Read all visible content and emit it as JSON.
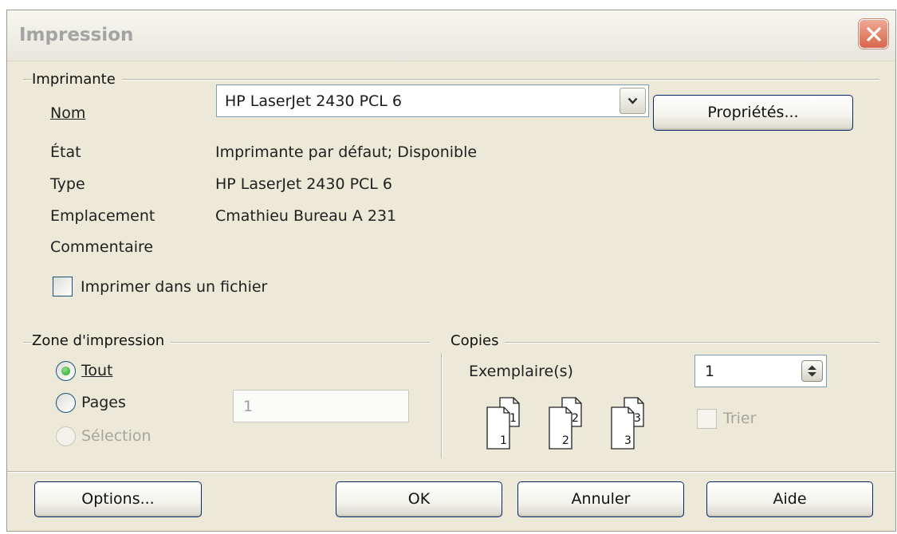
{
  "window": {
    "title": "Impression"
  },
  "printer": {
    "group_label": "Imprimante",
    "name_label": "Nom",
    "name_value": "HP LaserJet 2430 PCL 6",
    "properties_button": "Propriétés...",
    "status_label": "État",
    "status_value": "Imprimante par défaut; Disponible",
    "type_label": "Type",
    "type_value": "HP LaserJet 2430 PCL 6",
    "location_label": "Emplacement",
    "location_value": "Cmathieu Bureau A 231",
    "comment_label": "Commentaire",
    "comment_value": "",
    "print_to_file_label": "Imprimer dans un fichier",
    "print_to_file_checked": false
  },
  "print_range": {
    "group_label": "Zone d'impression",
    "all_label": "Tout",
    "pages_label": "Pages",
    "selection_label": "Sélection",
    "selected": "all",
    "pages_value": "1"
  },
  "copies": {
    "group_label": "Copies",
    "count_label": "Exemplaire(s)",
    "count_value": "1",
    "collate_label": "Trier",
    "collate_checked": false,
    "collate_icons": [
      {
        "back": "1",
        "front": "1"
      },
      {
        "back": "2",
        "front": "2"
      },
      {
        "back": "3",
        "front": "3"
      }
    ]
  },
  "buttons": {
    "options": "Options...",
    "ok": "OK",
    "cancel": "Annuler",
    "help": "Aide"
  },
  "icons": {
    "close": "close-icon",
    "combo_arrow": "chevron-down-icon",
    "spinner": "spin-arrows-icon",
    "collate_pages": "page-stack-icon"
  },
  "colors": {
    "dialog_bg": "#ece9d8",
    "close_button": "#d8674c",
    "button_border": "#0a2468",
    "radio_dot": "#21a121",
    "disabled_text": "#a8a69c"
  }
}
